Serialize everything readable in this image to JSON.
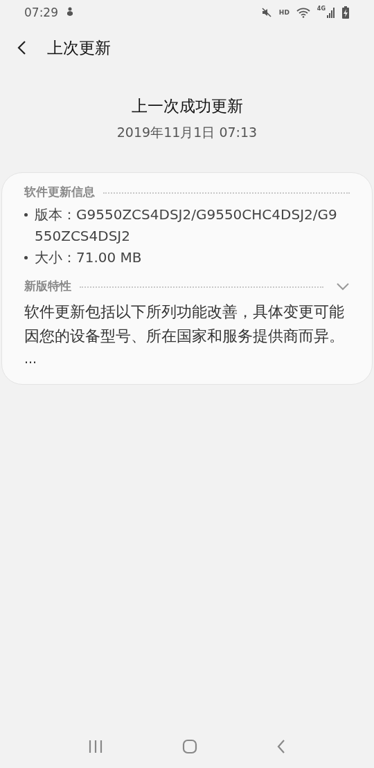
{
  "status_bar": {
    "time": "07:29",
    "hd": "HD",
    "network": "4G"
  },
  "header": {
    "title": "上次更新"
  },
  "summary": {
    "heading": "上一次成功更新",
    "date": "2019年11月1日 07:13"
  },
  "card": {
    "info_title": "软件更新信息",
    "info_items": [
      "版本：G9550ZCS4DSJ2/G9550CHC4DSJ2/G9550ZCS4DSJ2",
      "大小：71.00 MB"
    ],
    "features_title": "新版特性",
    "features_expanded": false,
    "features_text": "软件更新包括以下所列功能改善，具体变更可能因您的设备型号、所在国家和服务提供商而异。",
    "more": "..."
  }
}
